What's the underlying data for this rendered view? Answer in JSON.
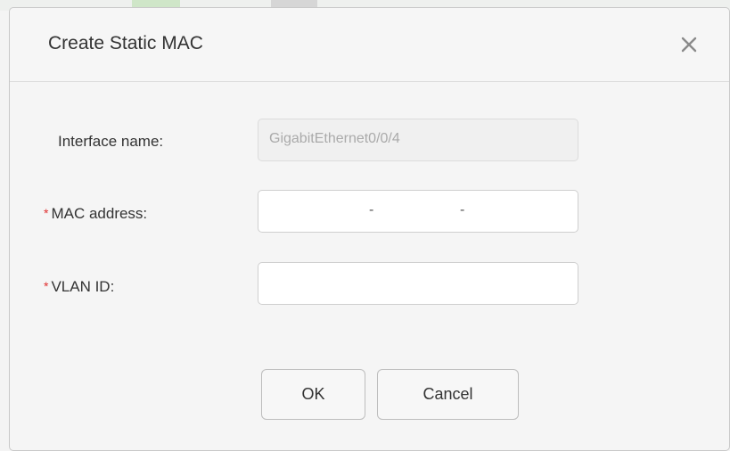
{
  "dialog": {
    "title": "Create Static MAC",
    "close_icon": "close-icon"
  },
  "form": {
    "interface_name": {
      "label": "Interface name:",
      "value": "GigabitEthernet0/0/4",
      "disabled": true
    },
    "mac_address": {
      "required_mark": "*",
      "label": "MAC address:",
      "value": "",
      "separator": "-"
    },
    "vlan_id": {
      "required_mark": "*",
      "label": "VLAN ID:",
      "value": ""
    }
  },
  "buttons": {
    "ok_label": "OK",
    "cancel_label": "Cancel"
  },
  "colors": {
    "required": "#e03030",
    "disabled_text": "#aaaaaa"
  }
}
